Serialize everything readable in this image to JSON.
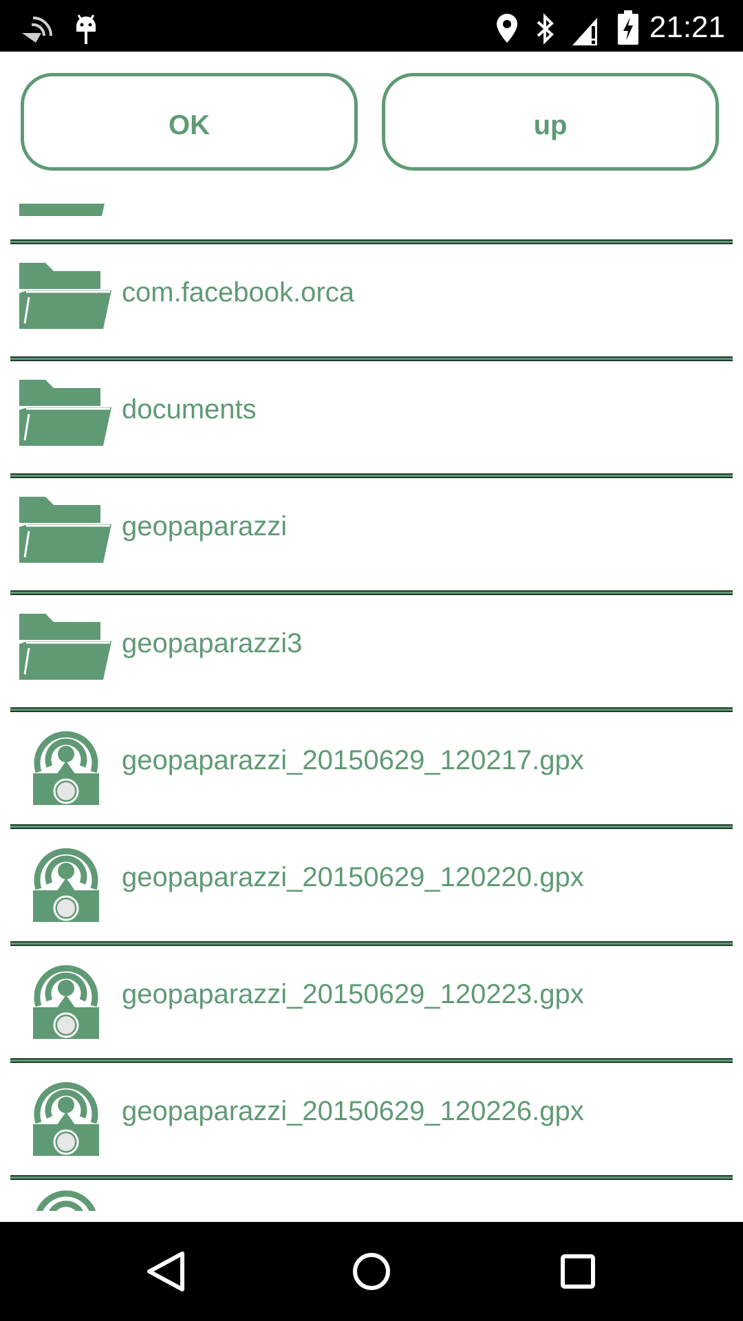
{
  "status_bar": {
    "time": "21:21"
  },
  "buttons": {
    "ok": "OK",
    "up": "up"
  },
  "file_list": [
    {
      "name": "com.facebook.orca",
      "type": "folder"
    },
    {
      "name": "documents",
      "type": "folder"
    },
    {
      "name": "geopaparazzi",
      "type": "folder"
    },
    {
      "name": "geopaparazzi3",
      "type": "folder"
    },
    {
      "name": "geopaparazzi_20150629_120217.gpx",
      "type": "gpx"
    },
    {
      "name": "geopaparazzi_20150629_120220.gpx",
      "type": "gpx"
    },
    {
      "name": "geopaparazzi_20150629_120223.gpx",
      "type": "gpx"
    },
    {
      "name": "geopaparazzi_20150629_120226.gpx",
      "type": "gpx"
    }
  ],
  "colors": {
    "accent": "#5f9a74",
    "bars": "#000000",
    "background": "#ffffff"
  },
  "icons": {
    "folder": "folder-icon",
    "gpx": "gps-camera-icon",
    "status": [
      "nfc-icon",
      "android-debug-icon",
      "location-icon",
      "bluetooth-icon",
      "signal-icon",
      "battery-icon"
    ],
    "navigation": [
      "back-icon",
      "home-icon",
      "recents-icon"
    ]
  }
}
